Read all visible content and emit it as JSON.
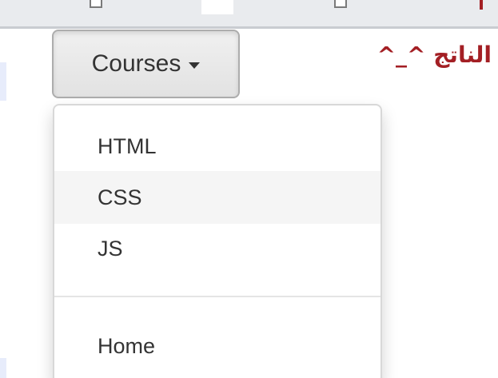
{
  "dropdown": {
    "toggle_label": "Courses",
    "caret_icon": "caret-down-icon",
    "items": [
      {
        "label": "HTML",
        "highlighted": false
      },
      {
        "label": "CSS",
        "highlighted": true
      },
      {
        "label": "JS",
        "highlighted": false
      }
    ],
    "footer_item": {
      "label": "Home"
    }
  },
  "result_label": "الناتج ^_^",
  "colors": {
    "accent": "#a31f24",
    "text": "#333333",
    "hover": "#f5f5f5"
  }
}
